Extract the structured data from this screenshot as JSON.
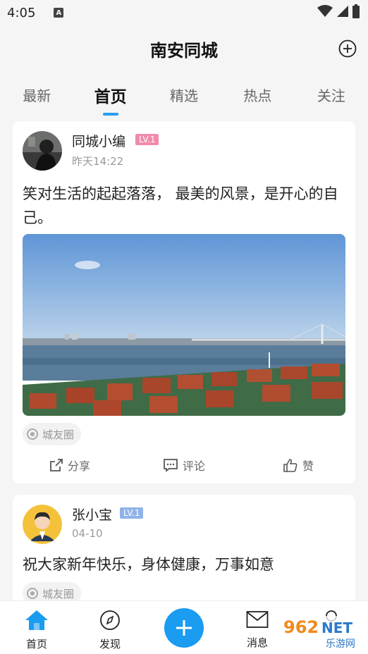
{
  "status_bar": {
    "time": "4:05",
    "notif_letter": "A"
  },
  "header": {
    "title": "南安同城"
  },
  "tabs": [
    {
      "label": "最新"
    },
    {
      "label": "首页"
    },
    {
      "label": "精选"
    },
    {
      "label": "热点"
    },
    {
      "label": "关注"
    }
  ],
  "active_tab": 1,
  "posts": [
    {
      "author": "同城小编",
      "level": "LV.1",
      "level_color": "#f08bab",
      "time": "昨天14:22",
      "text": "笑对生活的起起落落， 最美的风景，是开心的自己。",
      "tag": "城友圈",
      "actions": {
        "share": "分享",
        "comment": "评论",
        "like": "赞"
      }
    },
    {
      "author": "张小宝",
      "level": "LV.1",
      "level_color": "#8fb3e8",
      "time": "04-10",
      "text": "祝大家新年快乐，身体健康，万事如意",
      "tag": "城友圈"
    }
  ],
  "bottom_nav": {
    "home": "首页",
    "discover": "发现",
    "messages": "消息"
  },
  "watermark": {
    "brand": "962",
    "suffix": "NET",
    "sub": "乐游网"
  },
  "colors": {
    "accent": "#1a9cf0",
    "background": "#f5f5f5"
  }
}
